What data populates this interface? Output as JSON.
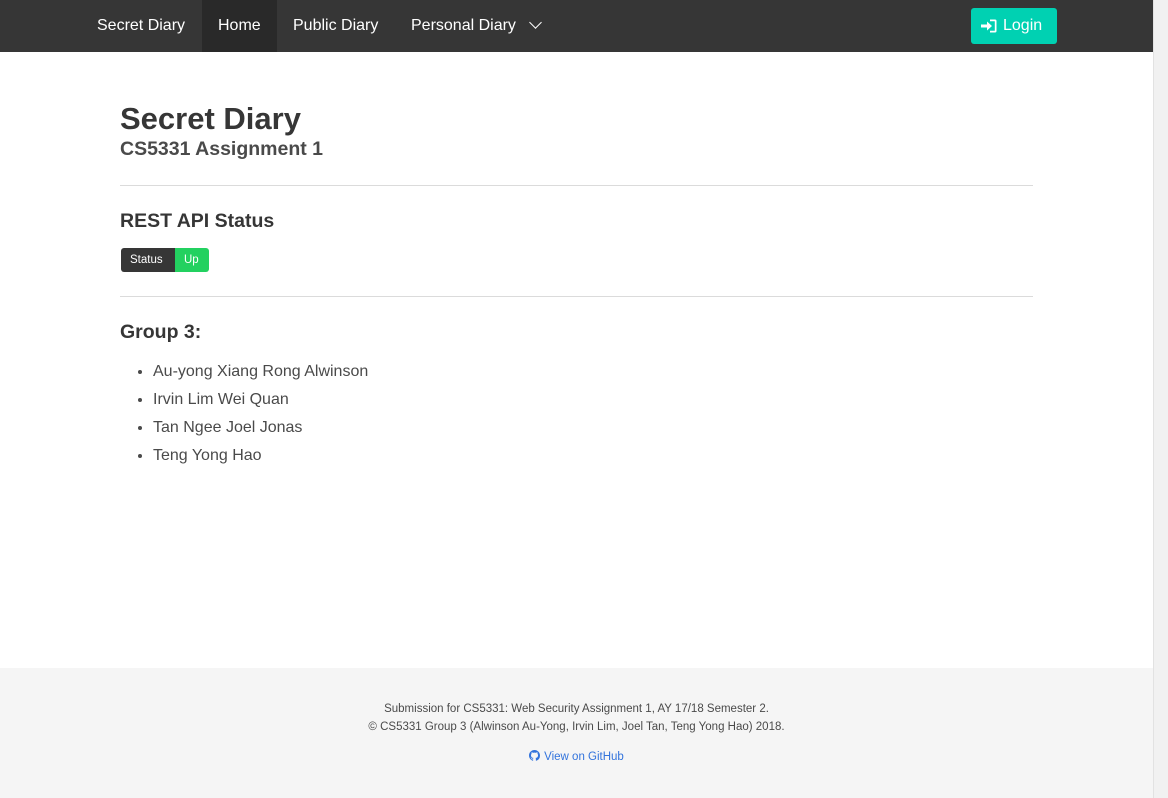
{
  "navbar": {
    "brand": "Secret Diary",
    "items": [
      {
        "label": "Home",
        "active": true
      },
      {
        "label": "Public Diary"
      },
      {
        "label": "Personal Diary"
      }
    ],
    "login_label": "Login",
    "login_icon": "sign-in-icon",
    "dropdown_icon": "chevron-down-icon"
  },
  "main": {
    "title": "Secret Diary",
    "subtitle": "CS5331 Assignment 1",
    "api_status": {
      "heading": "REST API Status",
      "badge_key": "Status",
      "badge_value": "Up"
    },
    "group": {
      "heading": "Group 3:",
      "members": [
        "Au-yong Xiang Rong Alwinson",
        "Irvin Lim Wei Quan",
        "Tan Ngee Joel Jonas",
        "Teng Yong Hao"
      ]
    }
  },
  "footer": {
    "line1": "Submission for CS5331: Web Security Assignment 1, AY 17/18 Semester 2.",
    "line2": "© CS5331 Group 3 (Alwinson Au-Yong, Irvin Lim, Joel Tan, Teng Yong Hao) 2018.",
    "github_label": "View on GitHub",
    "github_icon": "github-icon"
  },
  "colors": {
    "navbar_bg": "#363636",
    "active_nav_bg": "#292929",
    "login_button": "#00d1b2",
    "badge_key_bg": "#363636",
    "badge_up_bg": "#23d160",
    "link": "#3273dc",
    "footer_bg": "#f5f5f5"
  }
}
